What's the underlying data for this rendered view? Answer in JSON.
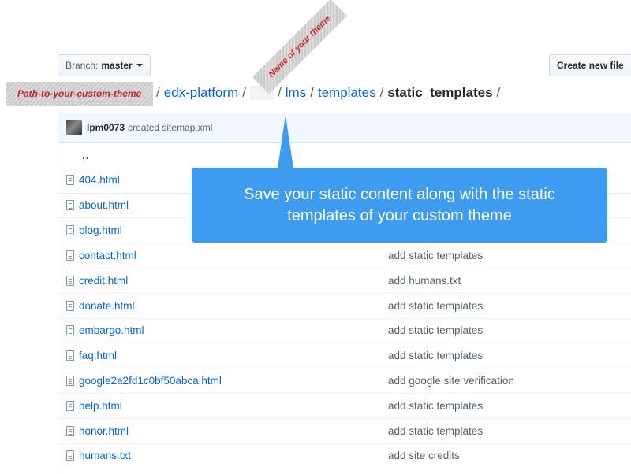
{
  "toolbar": {
    "branch_prefix": "Branch:",
    "branch_name": "master",
    "create_file_label": "Create new file"
  },
  "annotations": {
    "path_label": "Path-to-your-custom-theme",
    "theme_label": "Name of your theme",
    "callout_text": "Save your static content along with the static templates of your custom theme"
  },
  "breadcrumb": {
    "repo": "edx-platform",
    "seg1": "lms",
    "seg2": "templates",
    "current": "static_templates",
    "separator": "/"
  },
  "commit": {
    "author": "lpm0073",
    "message": "created sitemap.xml"
  },
  "up_dir": "..",
  "files": [
    {
      "name": "404.html",
      "message": ""
    },
    {
      "name": "about.html",
      "message": ""
    },
    {
      "name": "blog.html",
      "message": ""
    },
    {
      "name": "contact.html",
      "message": "add static templates"
    },
    {
      "name": "credit.html",
      "message": "add humans.txt"
    },
    {
      "name": "donate.html",
      "message": "add static templates"
    },
    {
      "name": "embargo.html",
      "message": "add static templates"
    },
    {
      "name": "faq.html",
      "message": "add static templates"
    },
    {
      "name": "google2a2fd1c0bf50abca.html",
      "message": "add google site verification"
    },
    {
      "name": "help.html",
      "message": "add static templates"
    },
    {
      "name": "honor.html",
      "message": "add static templates"
    },
    {
      "name": "humans.txt",
      "message": "add site credits"
    }
  ],
  "colors": {
    "link": "#0366d6",
    "callout": "#3d9bf0",
    "annotation_text": "#c0262c"
  }
}
